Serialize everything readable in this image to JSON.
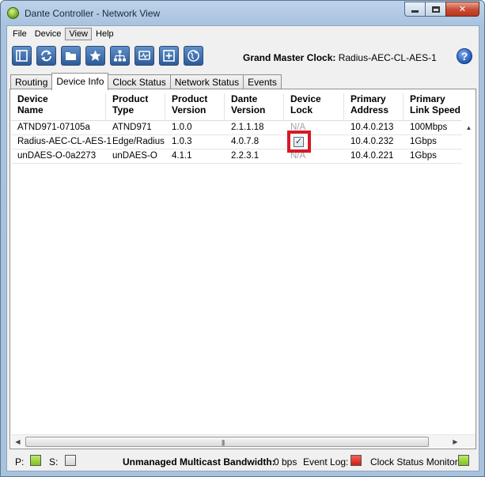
{
  "window": {
    "title": "Dante Controller - Network View"
  },
  "menu": {
    "items": [
      "File",
      "Device",
      "View",
      "Help"
    ]
  },
  "toolbar": {
    "buttons": [
      "sidebar-icon",
      "refresh-icon",
      "folder-icon",
      "star-icon",
      "network-icon",
      "monitor-icon",
      "add-icon",
      "globe-icon"
    ],
    "grand_master_label": "Grand Master Clock:",
    "grand_master_value": "Radius-AEC-CL-AES-1"
  },
  "tabs": [
    "Routing",
    "Device Info",
    "Clock Status",
    "Network Status",
    "Events"
  ],
  "active_tab": "Device Info",
  "table": {
    "headers": [
      [
        "Device",
        "Name"
      ],
      [
        "Product",
        "Type"
      ],
      [
        "Product",
        "Version"
      ],
      [
        "Dante",
        "Version"
      ],
      [
        "Device",
        "Lock"
      ],
      [
        "Primary",
        "Address"
      ],
      [
        "Primary",
        "Link Speed"
      ]
    ],
    "rows": [
      {
        "name": "ATND971-07105a",
        "type": "ATND971",
        "product_version": "1.0.0",
        "dante_version": "2.1.1.18",
        "lock": "N/A",
        "address": "10.4.0.213",
        "speed": "100Mbps"
      },
      {
        "name": "Radius-AEC-CL-AES-1",
        "type": "Edge/Radius",
        "product_version": "1.0.3",
        "dante_version": "4.0.7.8",
        "lock": "checked",
        "address": "10.4.0.232",
        "speed": "1Gbps"
      },
      {
        "name": "unDAES-O-0a2273",
        "type": "unDAES-O",
        "product_version": "4.1.1",
        "dante_version": "2.2.3.1",
        "lock": "N/A",
        "address": "10.4.0.221",
        "speed": "1Gbps"
      }
    ]
  },
  "status": {
    "p_label": "P:",
    "s_label": "S:",
    "multicast_label": "Unmanaged Multicast Bandwidth:",
    "multicast_value": "0 bps",
    "event_log_label": "Event Log:",
    "clock_monitor_label": "Clock Status Monitor:"
  },
  "colors": {
    "led_green": "#8fd12a",
    "led_red": "#e0231b",
    "highlight": "#d51a26"
  }
}
